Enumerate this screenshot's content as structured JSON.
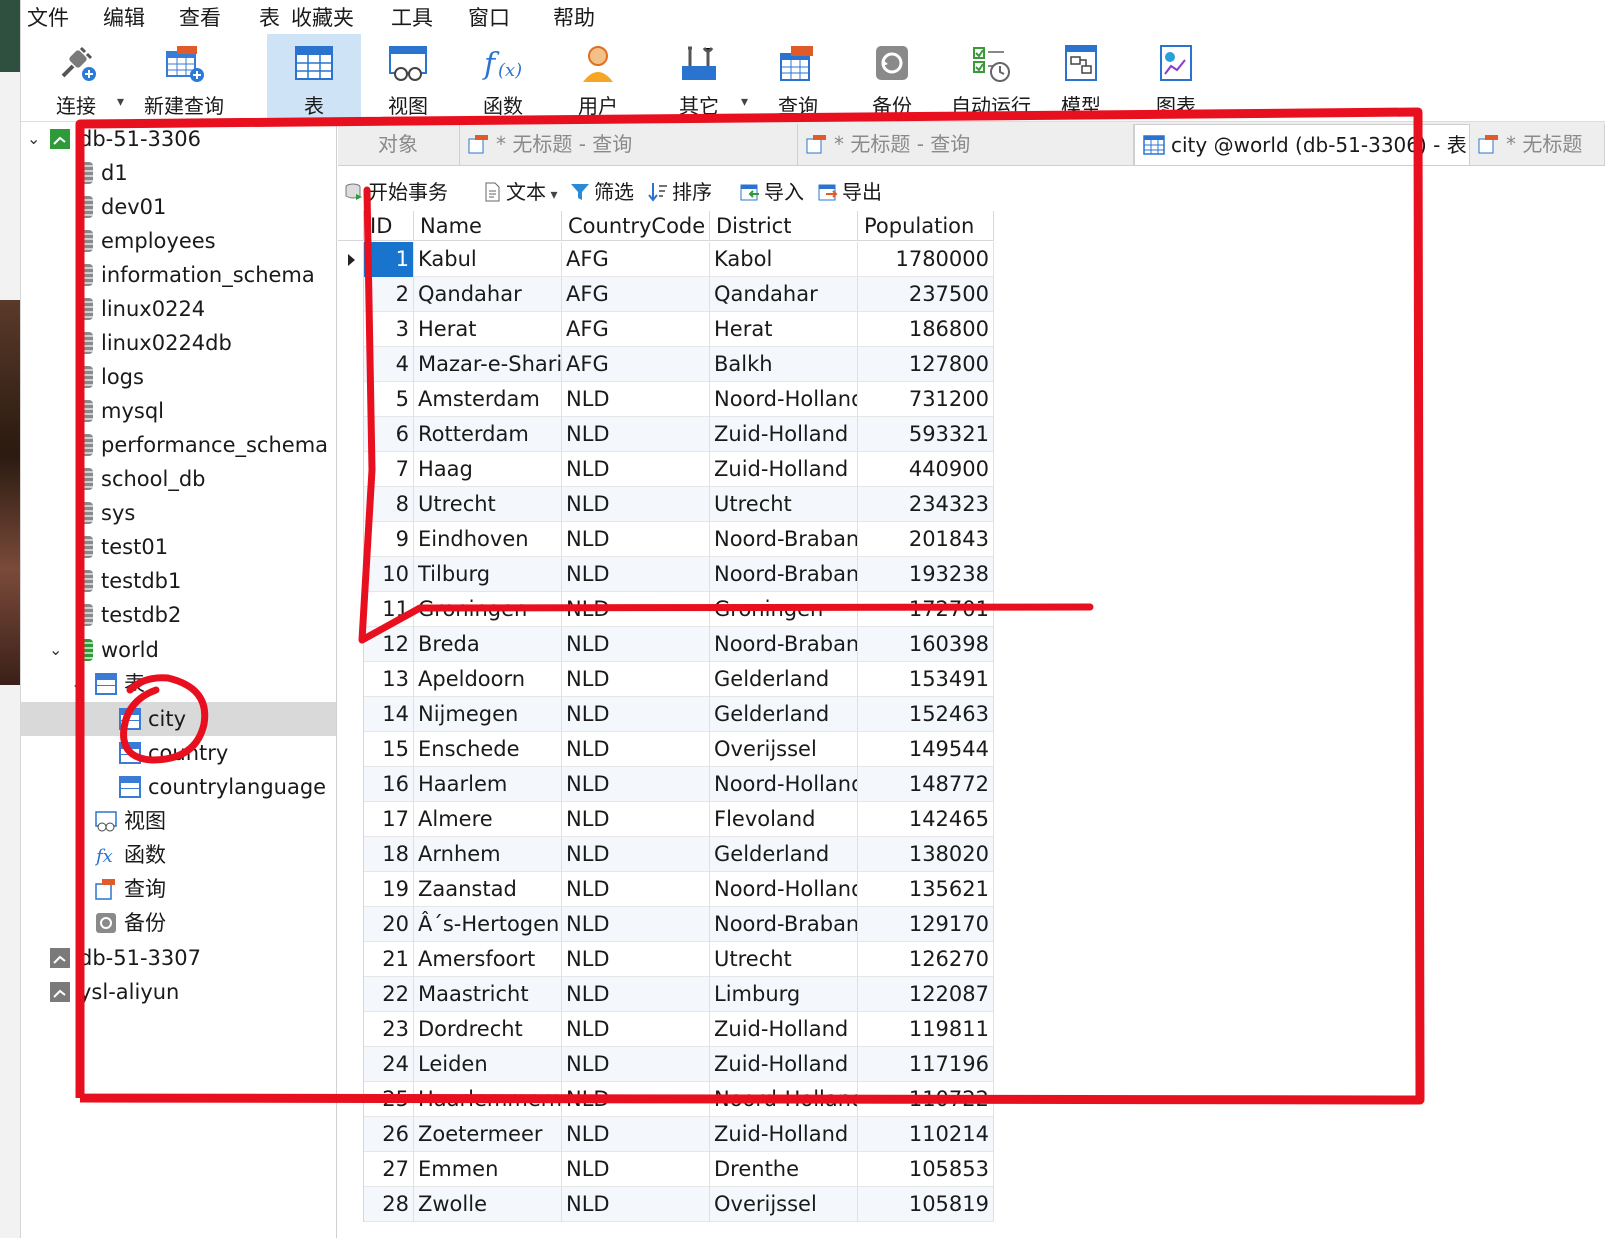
{
  "menu": [
    "文件",
    "编辑",
    "查看",
    "表",
    "收藏夹",
    "工具",
    "窗口",
    "帮助"
  ],
  "toolbar": {
    "connect": "连接",
    "new_query": "新建查询",
    "table": "表",
    "view": "视图",
    "function": "函数",
    "user": "用户",
    "other": "其它",
    "query": "查询",
    "backup": "备份",
    "autorun": "自动运行",
    "model": "模型",
    "chart": "图表"
  },
  "tree": {
    "connection_1": "db-51-3306",
    "databases": [
      "d1",
      "dev01",
      "employees",
      "information_schema",
      "linux0224",
      "linux0224db",
      "logs",
      "mysql",
      "performance_schema",
      "school_db",
      "sys",
      "test01",
      "testdb1",
      "testdb2"
    ],
    "world": "world",
    "tables_folder": "表",
    "tables": [
      "city",
      "country",
      "countrylanguage"
    ],
    "views": "视图",
    "functions": "函数",
    "queries": "查询",
    "backups": "备份",
    "connection_2": "db-51-3307",
    "connection_3": "ysl-aliyun"
  },
  "tabs": {
    "objects": "对象",
    "untitled_1": "* 无标题 - 查询",
    "untitled_2": "* 无标题 - 查询",
    "city": "city @world (db-51-3306) - 表",
    "untitled_3": "* 无标题"
  },
  "subtoolbar": {
    "begin_tx": "开始事务",
    "text": "文本",
    "filter": "筛选",
    "sort": "排序",
    "import": "导入",
    "export": "导出"
  },
  "grid": {
    "columns": [
      "ID",
      "Name",
      "CountryCode",
      "District",
      "Population"
    ],
    "rows": [
      [
        "1",
        "Kabul",
        "AFG",
        "Kabol",
        "1780000"
      ],
      [
        "2",
        "Qandahar",
        "AFG",
        "Qandahar",
        "237500"
      ],
      [
        "3",
        "Herat",
        "AFG",
        "Herat",
        "186800"
      ],
      [
        "4",
        "Mazar-e-Sharif",
        "AFG",
        "Balkh",
        "127800"
      ],
      [
        "5",
        "Amsterdam",
        "NLD",
        "Noord-Holland",
        "731200"
      ],
      [
        "6",
        "Rotterdam",
        "NLD",
        "Zuid-Holland",
        "593321"
      ],
      [
        "7",
        "Haag",
        "NLD",
        "Zuid-Holland",
        "440900"
      ],
      [
        "8",
        "Utrecht",
        "NLD",
        "Utrecht",
        "234323"
      ],
      [
        "9",
        "Eindhoven",
        "NLD",
        "Noord-Brabant",
        "201843"
      ],
      [
        "10",
        "Tilburg",
        "NLD",
        "Noord-Brabant",
        "193238"
      ],
      [
        "11",
        "Groningen",
        "NLD",
        "Groningen",
        "172701"
      ],
      [
        "12",
        "Breda",
        "NLD",
        "Noord-Brabant",
        "160398"
      ],
      [
        "13",
        "Apeldoorn",
        "NLD",
        "Gelderland",
        "153491"
      ],
      [
        "14",
        "Nijmegen",
        "NLD",
        "Gelderland",
        "152463"
      ],
      [
        "15",
        "Enschede",
        "NLD",
        "Overijssel",
        "149544"
      ],
      [
        "16",
        "Haarlem",
        "NLD",
        "Noord-Holland",
        "148772"
      ],
      [
        "17",
        "Almere",
        "NLD",
        "Flevoland",
        "142465"
      ],
      [
        "18",
        "Arnhem",
        "NLD",
        "Gelderland",
        "138020"
      ],
      [
        "19",
        "Zaanstad",
        "NLD",
        "Noord-Holland",
        "135621"
      ],
      [
        "20",
        "Â´s-Hertogenbosch",
        "NLD",
        "Noord-Brabant",
        "129170"
      ],
      [
        "21",
        "Amersfoort",
        "NLD",
        "Utrecht",
        "126270"
      ],
      [
        "22",
        "Maastricht",
        "NLD",
        "Limburg",
        "122087"
      ],
      [
        "23",
        "Dordrecht",
        "NLD",
        "Zuid-Holland",
        "119811"
      ],
      [
        "24",
        "Leiden",
        "NLD",
        "Zuid-Holland",
        "117196"
      ],
      [
        "25",
        "Haarlemmermeer",
        "NLD",
        "Noord-Holland",
        "110722"
      ],
      [
        "26",
        "Zoetermeer",
        "NLD",
        "Zuid-Holland",
        "110214"
      ],
      [
        "27",
        "Emmen",
        "NLD",
        "Drenthe",
        "105853"
      ],
      [
        "28",
        "Zwolle",
        "NLD",
        "Overijssel",
        "105819"
      ]
    ]
  },
  "colors": {
    "selection": "#1874cd",
    "annotation": "#e8101f",
    "active_tool": "#cfe3f7"
  }
}
